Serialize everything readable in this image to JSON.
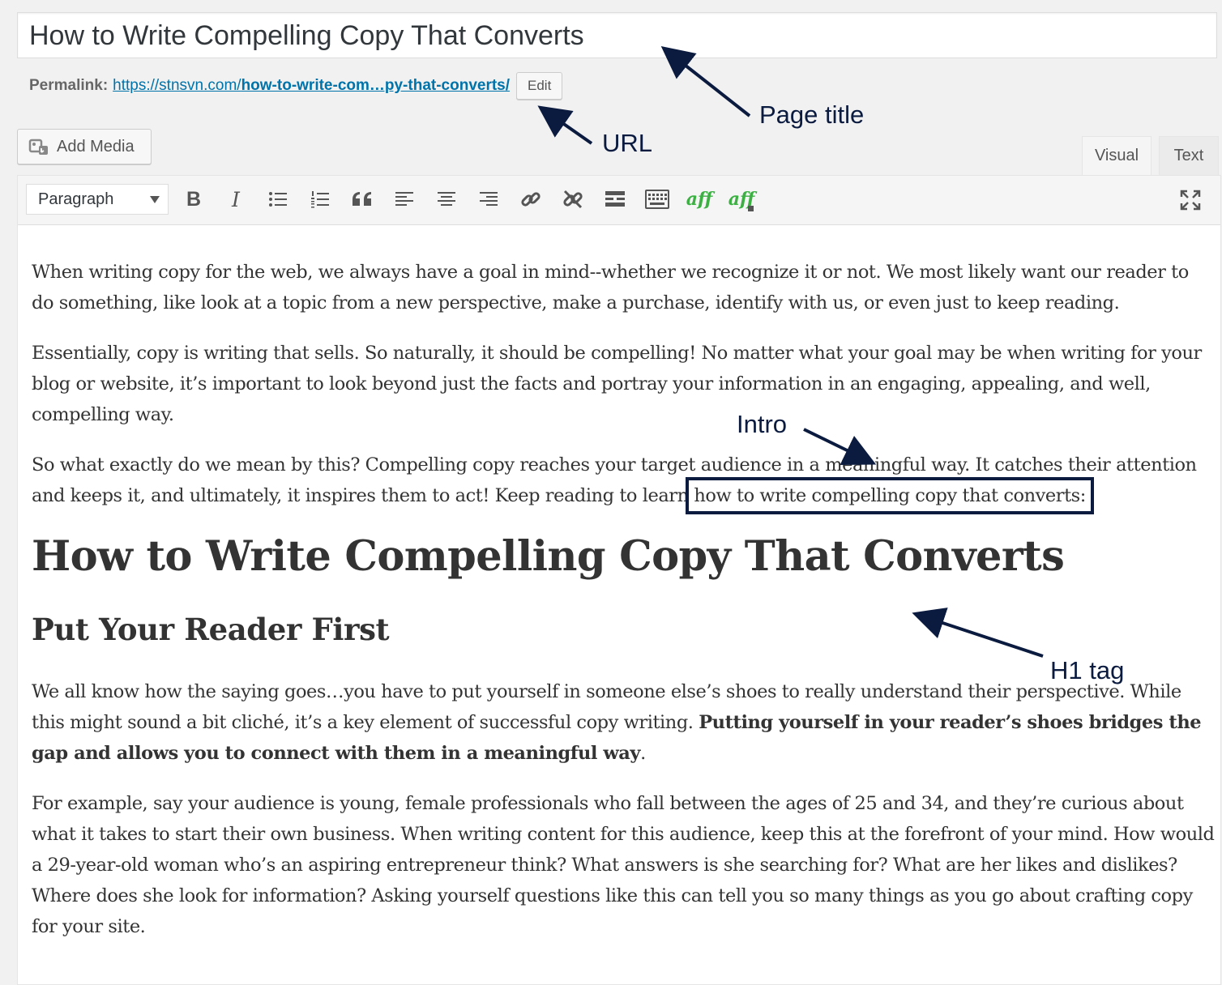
{
  "post": {
    "title": "How to Write Compelling Copy That Converts"
  },
  "permalink": {
    "label": "Permalink:",
    "url_prefix": "https://stnsvn.com/",
    "url_slug": "how-to-write-com…py-that-converts/",
    "edit_label": "Edit"
  },
  "toolbar": {
    "add_media_label": "Add Media",
    "format_select": "Paragraph",
    "buttons": [
      "bold-icon",
      "italic-icon",
      "bulleted-list-icon",
      "numbered-list-icon",
      "blockquote-icon",
      "align-left-icon",
      "align-center-icon",
      "align-right-icon",
      "link-icon",
      "unlink-icon",
      "read-more-icon",
      "toolbar-toggle-icon",
      "aff-icon",
      "aff-add-icon",
      "fullscreen-icon"
    ],
    "bold_glyph": "B",
    "italic_glyph": "I",
    "quote_glyph": "66",
    "aff_label": "aff"
  },
  "tabs": {
    "visual": "Visual",
    "text": "Text"
  },
  "content": {
    "p1": "When writing copy for the web, we always have a goal in mind--whether we recognize it or not. We most likely want our reader to do something, like look at a topic from a new perspective, make a purchase, identify with us, or even just to keep reading.",
    "p2": "Essentially, copy is writing that sells. So naturally, it should be compelling! No matter what your goal may be when writing for your blog or website, it’s important to look beyond just the facts and portray your information in an engaging, appealing, and well, compelling way.",
    "p3_start": "So what exactly do we mean by this? Compelling copy reaches your target audience in a meaningful way. It catches their attention and keeps it, and ultimately, it inspires them to act! Keep reading to learn ",
    "p3_highlight": "how to write compelling copy that converts:",
    "h1": "How to Write Compelling Copy That Converts",
    "h2": "Put Your Reader First",
    "p4_start": "We all know how the saying goes…you have to put yourself in someone else’s shoes to really understand their perspective. While this might sound a bit cliché, it’s a key element of successful copy writing. ",
    "p4_bold": "Putting yourself in your reader’s shoes bridges the gap and allows you to connect with them in a meaningful way",
    "p4_end": ".",
    "p5": "For example, say your audience is young, female professionals who fall between the ages of 25 and 34, and they’re curious about what it takes to start their own business. When writing content for this audience, keep this at the forefront of your mind. How would a 29-year-old woman who’s an aspiring entrepreneur think? What answers is she searching for? What are her likes and dislikes? Where does she look for information? Asking yourself questions like this can tell you so many things as you go about crafting copy for your site."
  },
  "annotations": {
    "page_title": "Page title",
    "url": "URL",
    "intro": "Intro",
    "h1_tag": "H1 tag"
  },
  "colors": {
    "link": "#0073aa",
    "annotation": "#0b1b3f",
    "aff": "#3cb043"
  }
}
